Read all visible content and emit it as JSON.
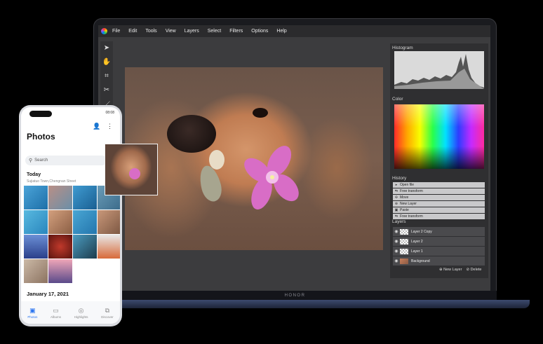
{
  "app": {
    "menu": [
      "File",
      "Edit",
      "Tools",
      "View",
      "Layers",
      "Select",
      "Filters",
      "Options",
      "Help"
    ]
  },
  "tools": [
    "pointer-icon",
    "hand-icon",
    "crop-icon",
    "magic-wand-icon",
    "brush-icon"
  ],
  "panels": {
    "histogram_title": "Histogram",
    "color_title": "Color",
    "history_title": "History",
    "history_items": [
      "Open file",
      "Free transform",
      "Move",
      "New Layer",
      "Paste",
      "Free transform"
    ],
    "layers_title": "Layers",
    "layers": [
      "Layer 2 Copy",
      "Layer 2",
      "Layer 1",
      "Background"
    ],
    "new_layer_label": "New Layer",
    "delete_label": "Delete"
  },
  "laptop": {
    "brand": "HONOR"
  },
  "phone": {
    "time": "08:08",
    "title": "Photos",
    "search_placeholder": "Search",
    "section_today": "Today",
    "location": "Sujiatuo Town,Chengnan Street",
    "section_date": "January 17, 2021",
    "nav": [
      "Photos",
      "Albums",
      "Highlights",
      "Discover"
    ]
  },
  "colors": {
    "accent_blue": "#2a74f0",
    "panel_bg": "#2f2f31",
    "menubar_bg": "#2b2b2d"
  }
}
